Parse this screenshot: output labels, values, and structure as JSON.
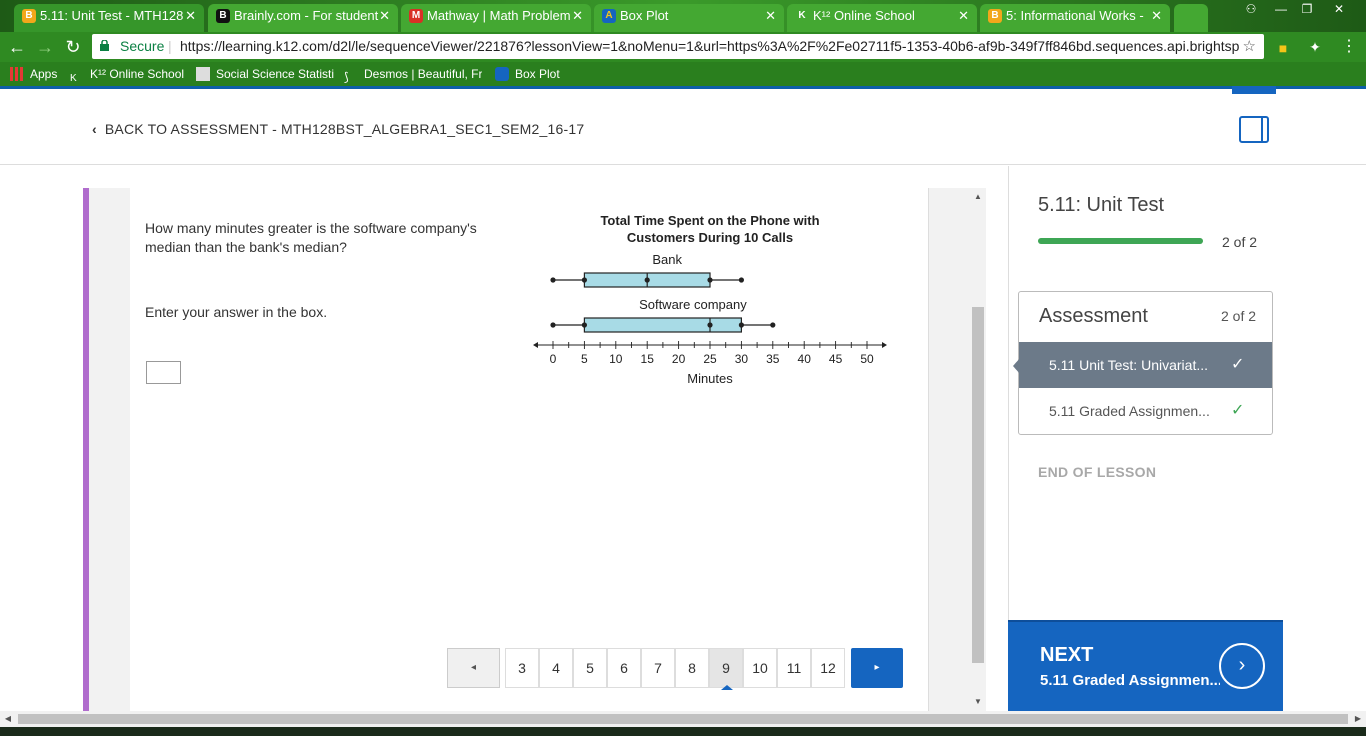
{
  "browser": {
    "tabs": [
      {
        "title": "5.11: Unit Test - MTH128",
        "icon": "B",
        "active": true
      },
      {
        "title": "Brainly.com - For student",
        "icon": "B",
        "active": false
      },
      {
        "title": "Mathway | Math Problem",
        "icon": "M",
        "active": false
      },
      {
        "title": "Box Plot",
        "icon": "A",
        "active": false
      },
      {
        "title": "K¹² Online School",
        "icon": "K",
        "active": false
      },
      {
        "title": "5: Informational Works -",
        "icon": "B",
        "active": false
      }
    ],
    "address": {
      "secure_label": "Secure",
      "url": "https://learning.k12.com/d2l/le/sequenceViewer/221876?lessonView=1&noMenu=1&url=https%3A%2F%2Fe02711f5-1353-40b6-af9b-349f7ff846bd.sequences.api.brightspace"
    },
    "bookmarks": [
      {
        "label": "Apps"
      },
      {
        "label": "K¹² Online School"
      },
      {
        "label": "Social Science Statistic"
      },
      {
        "label": "Desmos | Beautiful, Fr"
      },
      {
        "label": "Box Plot"
      }
    ]
  },
  "header": {
    "back_label": "BACK TO ASSESSMENT - MTH128BST_ALGEBRA1_SEC1_SEM2_16-17"
  },
  "question": {
    "text": "How many minutes greater is the software company's median than the bank's median?",
    "instruction": "Enter your answer in the box.",
    "answer_value": ""
  },
  "chart_data": {
    "type": "box",
    "title": "Total Time Spent on the Phone with Customers During 10 Calls",
    "xlabel": "Minutes",
    "xlim": [
      0,
      50
    ],
    "ticks": [
      0,
      5,
      10,
      15,
      20,
      25,
      30,
      35,
      40,
      45,
      50
    ],
    "series": [
      {
        "name": "Bank",
        "min": 0,
        "q1": 5,
        "median": 15,
        "q3": 25,
        "max": 30
      },
      {
        "name": "Software company",
        "min": 0,
        "q1": 5,
        "median": 25,
        "q3": 30,
        "max": 35
      }
    ],
    "box_color": "#a8dbe6"
  },
  "pagination": {
    "prev_icon": "◂",
    "next_icon": "▸",
    "pages": [
      "3",
      "4",
      "5",
      "6",
      "7",
      "8",
      "9",
      "10",
      "11",
      "12"
    ],
    "current": "9"
  },
  "sidebar": {
    "unit_title": "5.11: Unit Test",
    "progress_text": "2 of 2",
    "progress_fraction": 1.0,
    "assessment_title": "Assessment",
    "assessment_count": "2 of 2",
    "items": [
      {
        "label": "5.11 Unit Test: Univariat...",
        "state": "active"
      },
      {
        "label": "5.11 Graded Assignmen...",
        "state": "done"
      }
    ],
    "end_label": "END OF LESSON",
    "next_label": "NEXT",
    "next_sub": "5.11 Graded Assignmen..."
  },
  "colors": {
    "accent": "#1565c0",
    "progress": "#3ea655",
    "rail": "#b06ccd"
  }
}
